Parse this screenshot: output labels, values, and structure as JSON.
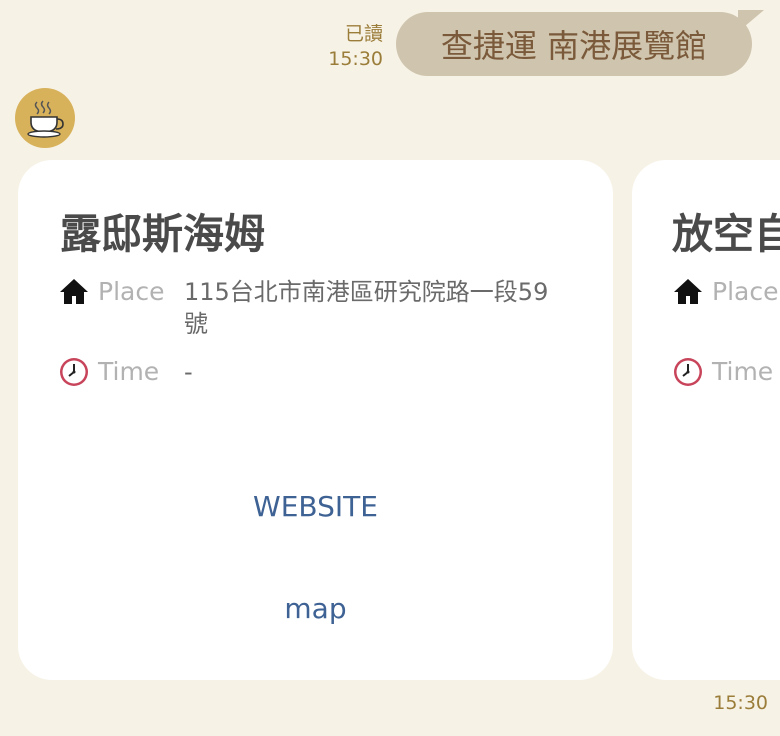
{
  "message": {
    "status": "已讀",
    "time": "15:30",
    "text": "查捷運 南港展覽館"
  },
  "avatar": {
    "icon": "coffee-cup-icon",
    "color": "#d8b25b"
  },
  "cards": [
    {
      "title": "露邸斯海姆",
      "place_icon": "home-icon",
      "place_label": "Place",
      "place_value": "115台北市南港區研究院路一段59號",
      "time_icon": "clock-icon",
      "time_label": "Time",
      "time_value": "-",
      "website_label": "WEBSITE",
      "map_label": "map"
    },
    {
      "title": "放空自",
      "place_icon": "home-icon",
      "place_label": "Place",
      "time_icon": "clock-icon",
      "time_label": "Time"
    }
  ],
  "reply_time": "15:30",
  "colors": {
    "background": "#f7f2e6",
    "bubble": "#cfc4ad",
    "link": "#3e6294",
    "meta": "#9b7d3a"
  }
}
